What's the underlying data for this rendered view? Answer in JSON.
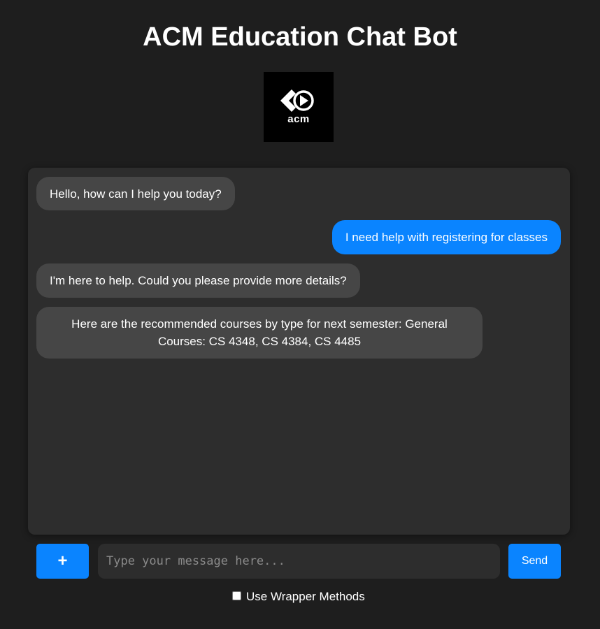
{
  "header": {
    "title": "ACM Education Chat Bot",
    "logo_text": "acm",
    "logo_icon": "acm-logo-icon"
  },
  "chat": {
    "messages": [
      {
        "sender": "bot",
        "text": "Hello, how can I help you today?"
      },
      {
        "sender": "user",
        "text": "I need help with registering for classes"
      },
      {
        "sender": "bot",
        "text": "I'm here to help. Could you please provide more details?"
      },
      {
        "sender": "bot",
        "text": "Here are the recommended courses by type for next semester: General Courses: CS 4348, CS 4384, CS 4485"
      }
    ]
  },
  "input_bar": {
    "plus_label": "+",
    "message_value": "",
    "message_placeholder": "Type your message here...",
    "send_label": "Send"
  },
  "options": {
    "wrapper_label": "Use Wrapper Methods",
    "wrapper_checked": false
  },
  "colors": {
    "background": "#1e1e1e",
    "chat_panel": "#2d2d2d",
    "bot_bubble": "#464646",
    "user_bubble": "#0a84ff",
    "accent": "#0a84ff"
  }
}
